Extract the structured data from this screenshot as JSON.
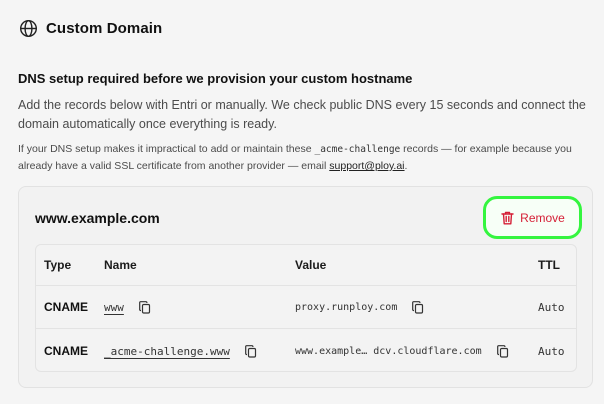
{
  "header": {
    "title": "Custom Domain",
    "icon": "globe-icon"
  },
  "section": {
    "title": "DNS setup required before we provision your custom hostname",
    "description": "Add the records below with Entri or manually. We check public DNS every 15 seconds and connect the domain automatically once everything is ready.",
    "note_prefix": "If your DNS setup makes it impractical to add or maintain these ",
    "note_code": "_acme-challenge",
    "note_suffix": " records — for example because you already have a valid SSL certificate from another provider — email ",
    "support_email": "support@ploy.ai",
    "note_end": "."
  },
  "domain_card": {
    "domain": "www.example.com",
    "remove_label": "Remove",
    "remove_icon": "trash-icon",
    "accent": "#d51f36",
    "highlight": "#34f53f"
  },
  "dns_table": {
    "columns": [
      "Type",
      "Name",
      "Value",
      "TTL"
    ],
    "rows": [
      {
        "type": "CNAME",
        "name": "www",
        "value": "proxy.runploy.com",
        "ttl": "Auto"
      },
      {
        "type": "CNAME",
        "name": "_acme-challenge.www",
        "value": "www.example… dcv.cloudflare.com",
        "ttl": "Auto"
      }
    ]
  }
}
